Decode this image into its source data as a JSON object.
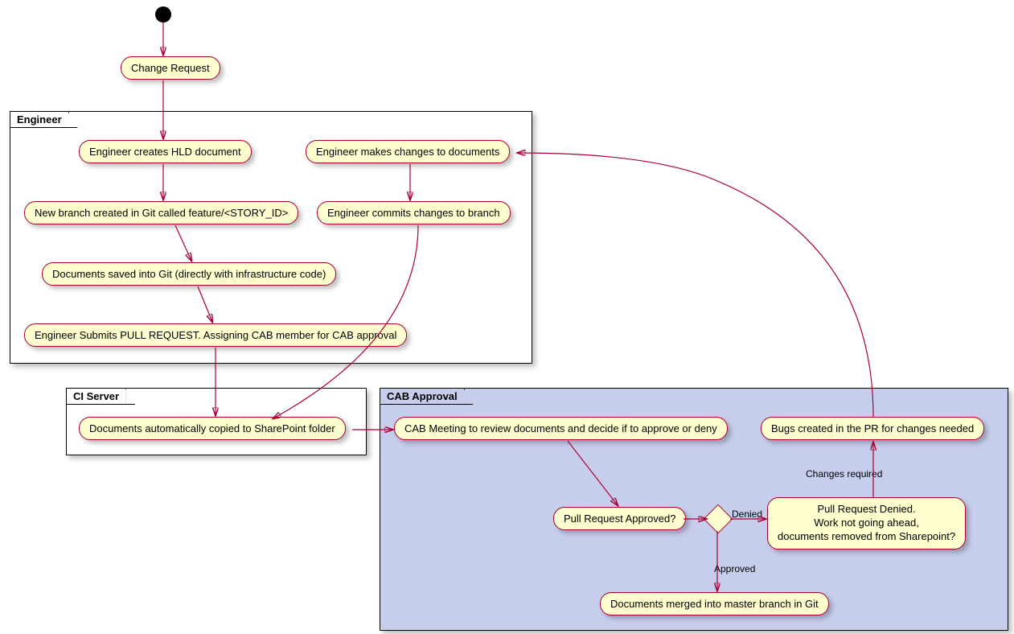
{
  "start": "",
  "nodes": {
    "change_request": "Change Request",
    "create_hld": "Engineer creates HLD document",
    "new_branch": "New branch created in Git called feature/<STORY_ID>",
    "docs_saved": "Documents saved into Git (directly with infrastructure code)",
    "submit_pr": "Engineer Submits PULL REQUEST. Assigning CAB member for CAB approval",
    "makes_changes": "Engineer makes changes to documents",
    "commits_changes": "Engineer commits changes to branch",
    "copied_sharepoint": "Documents automatically copied to SharePoint folder",
    "cab_meeting": "CAB Meeting to review documents and decide if to approve or deny",
    "bugs_created": "Bugs created in the PR for changes needed",
    "pr_approved_q": "Pull Request Approved?",
    "pr_denied": "Pull Request Denied.\nWork not going ahead,\ndocuments removed from Sharepoint?",
    "docs_merged": "Documents merged into master branch in Git"
  },
  "swimlanes": {
    "engineer": "Engineer",
    "ci_server": "CI Server",
    "cab_approval": "CAB Approval"
  },
  "edge_labels": {
    "denied": "Denied",
    "changes_required": "Changes required",
    "approved": "Approved"
  }
}
